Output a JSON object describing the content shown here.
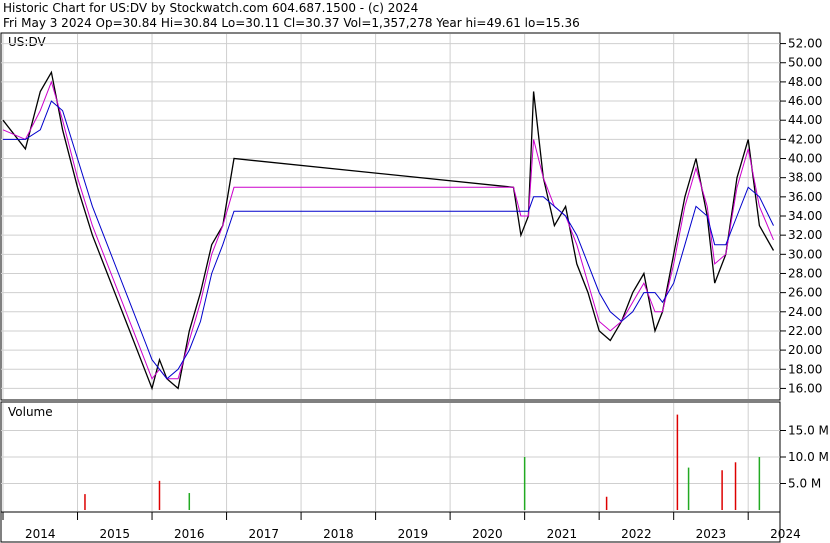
{
  "header": {
    "line1": "Historic Chart for US:DV by Stockwatch.com 604.687.1500 - (c) 2024",
    "line2": "Fri May  3 2024  Op=30.84  Hi=30.84  Lo=30.11  Cl=30.37  Vol=1,357,278  Year hi=49.61  lo=15.36"
  },
  "chart_data": [
    {
      "type": "line",
      "title": "US:DV",
      "ylim": [
        15,
        53
      ],
      "yticks": [
        "52.00",
        "50.00",
        "48.00",
        "46.00",
        "44.00",
        "42.00",
        "40.00",
        "38.00",
        "36.00",
        "34.00",
        "32.00",
        "30.00",
        "28.00",
        "26.00",
        "24.00",
        "22.00",
        "20.00",
        "18.00",
        "16.00"
      ],
      "xticks": [
        "2014",
        "2015",
        "2016",
        "2017",
        "2018",
        "2019",
        "2020",
        "2021",
        "2022",
        "2023",
        "2024"
      ],
      "grid": true,
      "series": [
        {
          "name": "price",
          "color": "#000000",
          "x": [
            2014.0,
            2014.3,
            2014.5,
            2014.65,
            2014.8,
            2015.0,
            2015.2,
            2015.4,
            2015.55,
            2015.7,
            2015.9,
            2016.0,
            2016.1,
            2016.2,
            2016.35,
            2016.5,
            2016.65,
            2016.8,
            2016.95,
            2017.1,
            2020.85,
            2020.95,
            2021.05,
            2021.12,
            2021.25,
            2021.4,
            2021.55,
            2021.7,
            2021.85,
            2022.0,
            2022.15,
            2022.3,
            2022.45,
            2022.6,
            2022.75,
            2022.85,
            2023.0,
            2023.15,
            2023.3,
            2023.45,
            2023.55,
            2023.7,
            2023.85,
            2024.0,
            2024.15,
            2024.34
          ],
          "values": [
            44,
            41,
            47,
            49,
            43,
            37,
            32,
            28,
            25,
            22,
            18,
            16,
            19,
            17,
            16,
            22,
            26,
            31,
            33,
            40,
            37,
            32,
            34,
            47,
            38,
            33,
            35,
            29,
            26,
            22,
            21,
            23,
            26,
            28,
            22,
            24,
            30,
            36,
            40,
            34,
            27,
            30,
            38,
            42,
            33,
            30.4
          ]
        },
        {
          "name": "ma_short",
          "color": "#cc00cc",
          "x": [
            2014.0,
            2014.3,
            2014.5,
            2014.65,
            2014.8,
            2015.0,
            2015.2,
            2015.4,
            2015.55,
            2015.7,
            2015.9,
            2016.0,
            2016.1,
            2016.2,
            2016.35,
            2016.5,
            2016.65,
            2016.8,
            2016.95,
            2017.1,
            2020.85,
            2020.95,
            2021.05,
            2021.12,
            2021.25,
            2021.4,
            2021.55,
            2021.7,
            2021.85,
            2022.0,
            2022.15,
            2022.3,
            2022.45,
            2022.6,
            2022.75,
            2022.85,
            2023.0,
            2023.15,
            2023.3,
            2023.45,
            2023.55,
            2023.7,
            2023.85,
            2024.0,
            2024.15,
            2024.34
          ],
          "values": [
            43,
            42,
            45,
            48,
            44,
            38,
            33,
            29,
            26,
            23,
            19,
            17,
            18,
            17,
            17,
            21,
            25,
            30,
            33,
            37,
            37,
            34,
            34,
            42,
            38,
            35,
            34,
            31,
            27,
            23,
            22,
            23,
            25,
            27,
            24,
            24,
            29,
            35,
            39,
            35,
            29,
            30,
            37,
            41,
            35,
            31.5
          ]
        },
        {
          "name": "ma_long",
          "color": "#0000cc",
          "x": [
            2014.0,
            2014.3,
            2014.5,
            2014.65,
            2014.8,
            2015.0,
            2015.2,
            2015.4,
            2015.55,
            2015.7,
            2015.9,
            2016.0,
            2016.1,
            2016.2,
            2016.35,
            2016.5,
            2016.65,
            2016.8,
            2016.95,
            2017.1,
            2020.85,
            2020.95,
            2021.05,
            2021.12,
            2021.25,
            2021.4,
            2021.55,
            2021.7,
            2021.85,
            2022.0,
            2022.15,
            2022.3,
            2022.45,
            2022.6,
            2022.75,
            2022.85,
            2023.0,
            2023.15,
            2023.3,
            2023.45,
            2023.55,
            2023.7,
            2023.85,
            2024.0,
            2024.15,
            2024.34
          ],
          "values": [
            42,
            42,
            43,
            46,
            45,
            40,
            35,
            31,
            28,
            25,
            21,
            19,
            18,
            17,
            18,
            20,
            23,
            28,
            31,
            34.5,
            34.5,
            34.5,
            34.5,
            36,
            36,
            35,
            34,
            32,
            29,
            26,
            24,
            23,
            24,
            26,
            26,
            25,
            27,
            31,
            35,
            34,
            31,
            31,
            34,
            37,
            36,
            33
          ]
        }
      ]
    },
    {
      "type": "bar",
      "title": "Volume",
      "ylim": [
        0,
        20
      ],
      "yticks": [
        "15.0 M",
        "10.0 M",
        "5.0 M"
      ],
      "series": [
        {
          "name": "spikes",
          "values": [
            {
              "x": 2021.0,
              "v": 10
            },
            {
              "x": 2022.1,
              "v": 2.5
            },
            {
              "x": 2023.05,
              "v": 18
            },
            {
              "x": 2023.2,
              "v": 8
            },
            {
              "x": 2023.65,
              "v": 7.5
            },
            {
              "x": 2023.83,
              "v": 9
            },
            {
              "x": 2024.15,
              "v": 10
            },
            {
              "x": 2015.1,
              "v": 3
            },
            {
              "x": 2016.1,
              "v": 5.5
            },
            {
              "x": 2016.5,
              "v": 3.2
            }
          ]
        }
      ]
    }
  ],
  "colors": {
    "price": "#000000",
    "ma_short": "#cc00cc",
    "ma_long": "#0000cc",
    "vol_up": "#22aa22",
    "vol_down": "#dd0000",
    "grid": "#cfcfcf"
  }
}
